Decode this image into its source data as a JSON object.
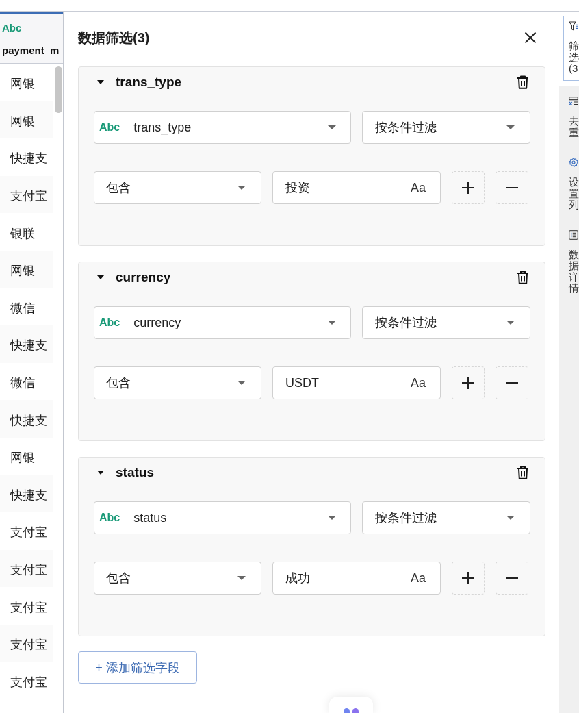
{
  "table": {
    "column": {
      "type_tag": "Abc",
      "header": "payment_m"
    },
    "rows": [
      "网银",
      "网银",
      "快捷支",
      "支付宝",
      "银联",
      "网银",
      "微信",
      "快捷支",
      "微信",
      "快捷支",
      "网银",
      "快捷支",
      "支付宝",
      "支付宝",
      "支付宝",
      "支付宝",
      "支付宝"
    ]
  },
  "filter_panel": {
    "title": "数据筛选(3)",
    "filters": [
      {
        "name": "trans_type",
        "expanded": true,
        "field": {
          "type_tag": "Abc",
          "name": "trans_type"
        },
        "mode": "按条件过滤",
        "operator": "包含",
        "value": "投资",
        "case_toggle": "Aa"
      },
      {
        "name": "currency",
        "expanded": true,
        "field": {
          "type_tag": "Abc",
          "name": "currency"
        },
        "mode": "按条件过滤",
        "operator": "包含",
        "value": "USDT",
        "case_toggle": "Aa"
      },
      {
        "name": "status",
        "expanded": true,
        "field": {
          "type_tag": "Abc",
          "name": "status"
        },
        "mode": "按条件过滤",
        "operator": "包含",
        "value": "成功",
        "case_toggle": "Aa"
      }
    ],
    "add_button": "+ 添加筛选字段"
  },
  "sidebar": {
    "items": [
      {
        "label": "筛选(3",
        "selected": true
      },
      {
        "label": "去重",
        "selected": false
      },
      {
        "label": "设置列",
        "selected": false
      },
      {
        "label": "数据详情",
        "selected": false
      }
    ]
  }
}
